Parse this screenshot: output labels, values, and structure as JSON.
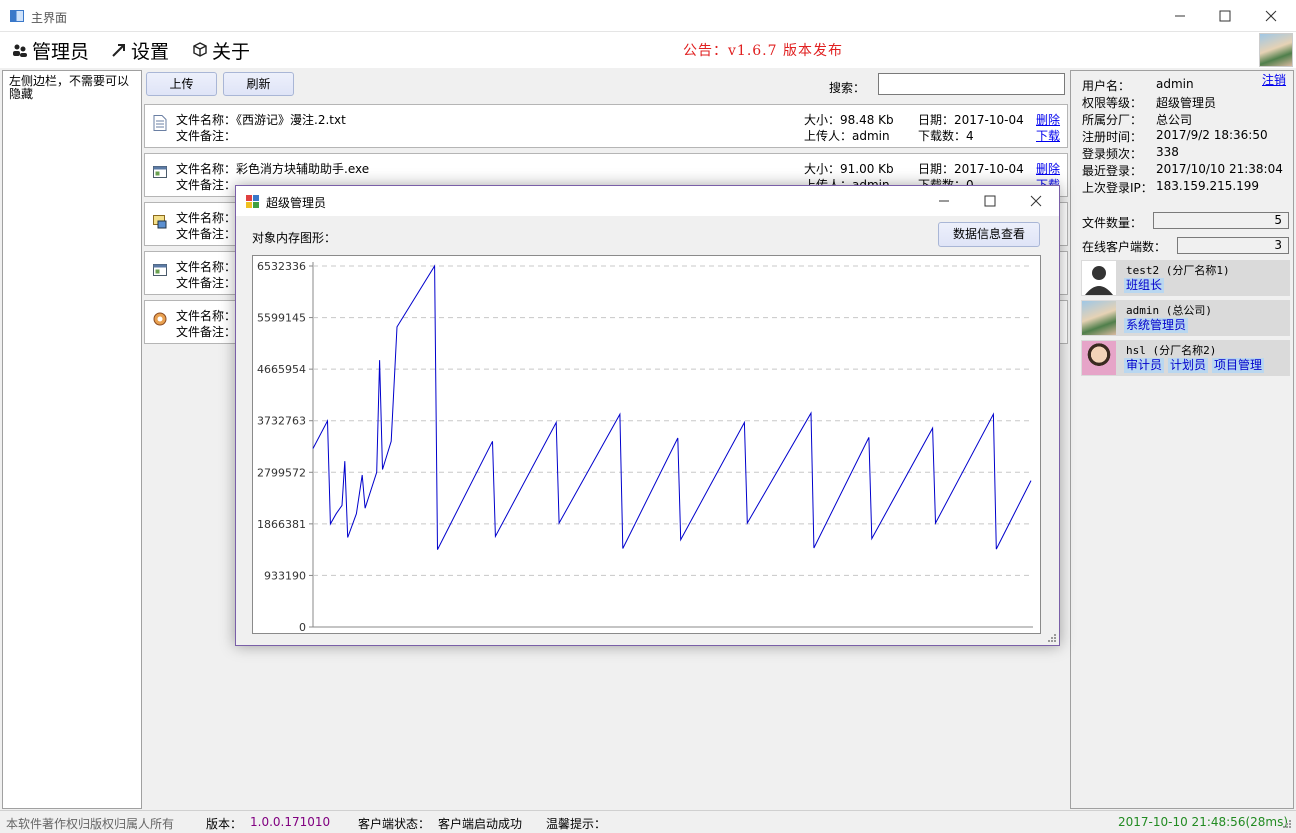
{
  "window": {
    "title": "主界面"
  },
  "menu": {
    "items": [
      {
        "label": "管理员",
        "icon": "users-icon"
      },
      {
        "label": "设置",
        "icon": "wrench-icon"
      },
      {
        "label": "关于",
        "icon": "cube-icon"
      }
    ],
    "announcement": "公告：v1.6.7 版本发布"
  },
  "left_sidebar": {
    "text": "左侧边栏，不需要可以隐藏"
  },
  "toolbar": {
    "upload_label": "上传",
    "refresh_label": "刷新",
    "search_label": "搜索：",
    "search_value": ""
  },
  "files": [
    {
      "name": "文件名称：《西游记》漫注.2.txt",
      "note": "文件备注：",
      "size": "大小：98.48 Kb",
      "uploader": "上传人：admin",
      "date": "日期：2017-10-04",
      "downloads": "下载数：4",
      "delete_label": "删除",
      "download_label": "下载",
      "icon": "text-file-icon"
    },
    {
      "name": "文件名称：彩色消方块辅助助手.exe",
      "note": "文件备注：",
      "size": "大小：91.00 Kb",
      "uploader": "上传人：admin",
      "date": "日期：2017-10-04",
      "downloads": "下载数：0",
      "delete_label": "删除",
      "download_label": "下载",
      "icon": "exe-file-icon"
    },
    {
      "name": "文件名称：",
      "note": "文件备注：",
      "icon": "install-file-icon"
    },
    {
      "name": "文件名称：",
      "note": "文件备注：",
      "icon": "exe-file-icon"
    },
    {
      "name": "文件名称：",
      "note": "文件备注：",
      "icon": "package-file-icon"
    }
  ],
  "user_info": {
    "logout_label": "注销",
    "rows": [
      {
        "label": "用户名：",
        "value": "admin"
      },
      {
        "label": "权限等级：",
        "value": "超级管理员"
      },
      {
        "label": "所属分厂：",
        "value": "总公司"
      },
      {
        "label": "注册时间：",
        "value": "2017/9/2 18:36:50"
      },
      {
        "label": "登录频次：",
        "value": "338"
      },
      {
        "label": "最近登录：",
        "value": "2017/10/10 21:38:04"
      },
      {
        "label": "上次登录IP：",
        "value": "183.159.215.199"
      }
    ],
    "file_count_label": "文件数量：",
    "file_count": "5",
    "online_label": "在线客户端数：",
    "online_count": "3"
  },
  "clients": [
    {
      "name": "test2 (分厂名称1)",
      "roles": [
        "班组长"
      ],
      "avatar": "default-avatar"
    },
    {
      "name": "admin (总公司)",
      "roles": [
        "系统管理员"
      ],
      "avatar": "photo-avatar"
    },
    {
      "name": "hsl (分厂名称2)",
      "roles": [
        "审计员",
        "计划员",
        "项目管理"
      ],
      "avatar": "girl-avatar"
    }
  ],
  "statusbar": {
    "copyright": "本软件著作权归版权归属人所有",
    "version_label": "版本：",
    "version": "1.0.0.171010",
    "client_status_label": "客户端状态：",
    "client_status": "客户端启动成功",
    "tip_label": "温馨提示：",
    "time": "2017-10-10 21:48:56(28ms)"
  },
  "dialog": {
    "title": "超级管理员",
    "label": "对象内存图形：",
    "view_button": "数据信息查看"
  },
  "colors": {
    "announcement": "#e02020",
    "link": "#0000ee",
    "version": "#800080",
    "time": "#228b22",
    "line": "#0000cc"
  },
  "chart_data": {
    "type": "line",
    "yticks": [
      "6532336",
      "5599145",
      "4665954",
      "3732763",
      "2799572",
      "1866381",
      "933190",
      "0"
    ],
    "ylim": [
      0,
      6532336
    ],
    "grid": true,
    "series": [
      {
        "values": [
          [
            0,
            3230000
          ],
          [
            5,
            3730000
          ],
          [
            6,
            1866381
          ],
          [
            8,
            2050000
          ],
          [
            10,
            2200000
          ],
          [
            11,
            3000000
          ],
          [
            12,
            1620000
          ],
          [
            15,
            2050000
          ],
          [
            17,
            2750000
          ],
          [
            18,
            2150000
          ],
          [
            22,
            2800000
          ],
          [
            23,
            4830000
          ],
          [
            24,
            2850000
          ],
          [
            27,
            3360000
          ],
          [
            29,
            5430000
          ],
          [
            42,
            6532336
          ],
          [
            43,
            1400000
          ],
          [
            62,
            3360000
          ],
          [
            63,
            1640000
          ],
          [
            84,
            3700000
          ],
          [
            85,
            1880000
          ],
          [
            106,
            3850000
          ],
          [
            107,
            1420000
          ],
          [
            126,
            3420000
          ],
          [
            127,
            1580000
          ],
          [
            149,
            3700000
          ],
          [
            150,
            1880000
          ],
          [
            172,
            3870000
          ],
          [
            173,
            1430000
          ],
          [
            192,
            3430000
          ],
          [
            193,
            1600000
          ],
          [
            214,
            3600000
          ],
          [
            215,
            1880000
          ],
          [
            235,
            3850000
          ],
          [
            236,
            1410000
          ],
          [
            248,
            2650000
          ]
        ]
      }
    ]
  }
}
